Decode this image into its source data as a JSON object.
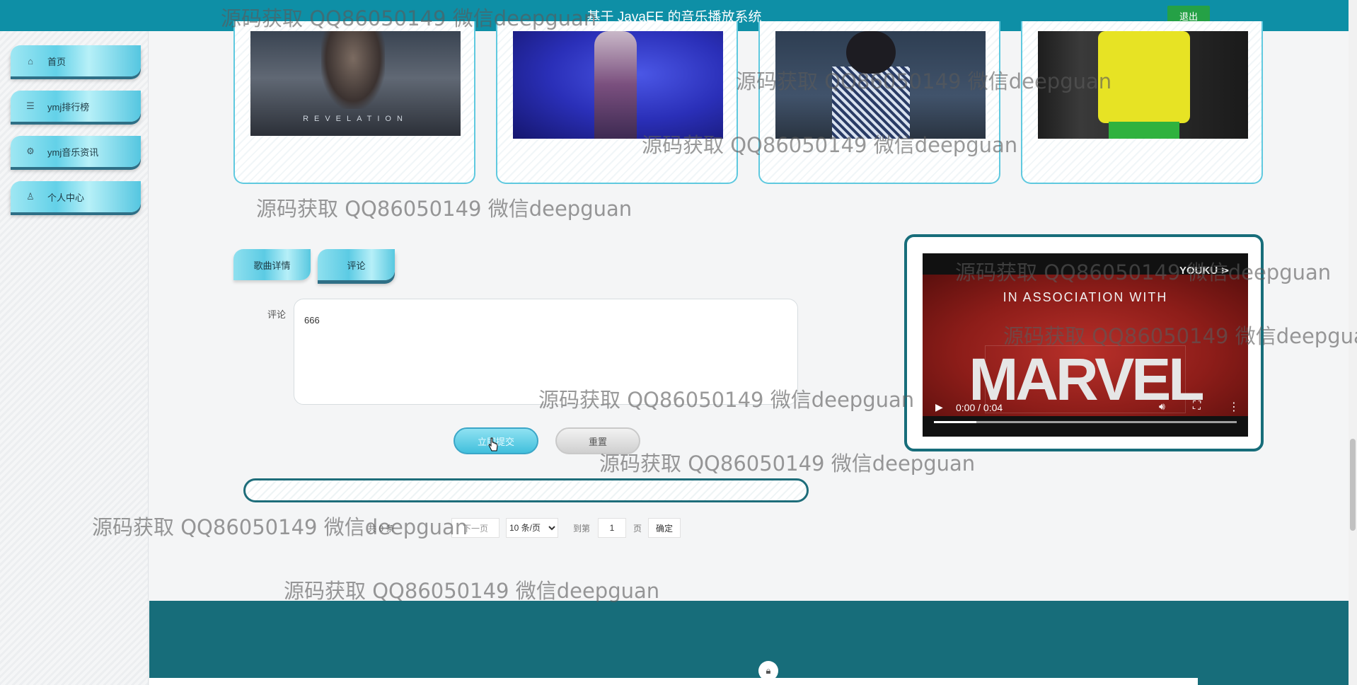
{
  "header": {
    "title": "基于 JavaEE 的音乐播放系统",
    "logout_label": "退出"
  },
  "sidebar": {
    "items": [
      {
        "label": "首页",
        "icon": "home-icon"
      },
      {
        "label": "ymj排行榜",
        "icon": "sliders-icon"
      },
      {
        "label": "ymj音乐资讯",
        "icon": "gear-icon"
      },
      {
        "label": "个人中心",
        "icon": "user-icon"
      }
    ]
  },
  "thumbnails": [
    {
      "caption": "REVELATION"
    },
    {
      "caption": ""
    },
    {
      "caption": ""
    },
    {
      "caption": ""
    }
  ],
  "tabs": [
    {
      "label": "歌曲详情"
    },
    {
      "label": "评论"
    }
  ],
  "comment_form": {
    "label": "评论",
    "value": "666",
    "submit_label": "立即提交",
    "reset_label": "重置"
  },
  "pagination": {
    "total_text": "共 0 条",
    "next_label": "下一页",
    "page_size": "10 条/页",
    "goto_prefix": "到第",
    "goto_value": "1",
    "goto_suffix": "页",
    "confirm_label": "确定"
  },
  "video": {
    "brand": "YOUKU ⋗",
    "line1": "IN ASSOCIATION WITH",
    "line2": "MARVEL",
    "time": "0:00 / 0:04",
    "progress_fraction": 0.14
  },
  "watermark": "源码获取 QQ86050149 微信deepguan",
  "colors": {
    "accent": "#0e8fa6",
    "footer": "#176d7a",
    "logout": "#25a146"
  }
}
